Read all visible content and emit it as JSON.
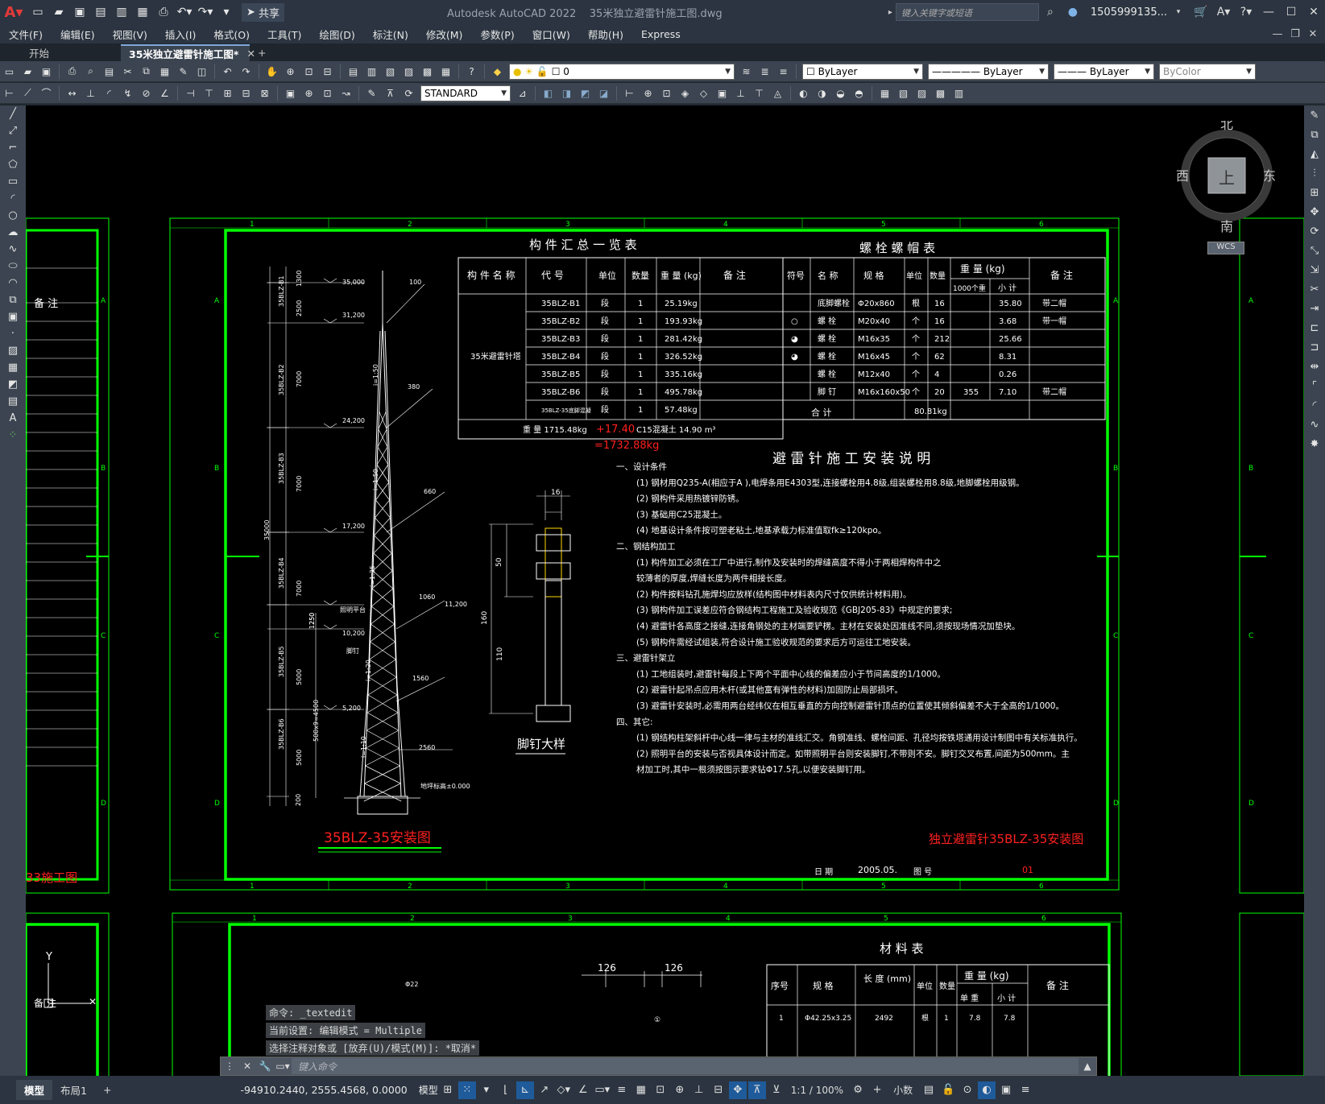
{
  "titlebar": {
    "app": "Autodesk AutoCAD 2022",
    "file": "35米独立避雷针施工图.dwg",
    "share": "共享",
    "search_placeholder": "键入关键字或短语",
    "user": "1505999135..."
  },
  "menu": [
    "文件(F)",
    "编辑(E)",
    "视图(V)",
    "插入(I)",
    "格式(O)",
    "工具(T)",
    "绘图(D)",
    "标注(N)",
    "修改(M)",
    "参数(P)",
    "窗口(W)",
    "帮助(H)",
    "Express"
  ],
  "tabs": [
    {
      "label": "开始"
    },
    {
      "label": "35米独立避雷针施工图*"
    }
  ],
  "toolbar": {
    "layer": "0",
    "color": "ByLayer",
    "linetype": "ByLayer",
    "lineweight": "ByLayer",
    "plotstyle": "ByColor",
    "textstyle": "STANDARD"
  },
  "compass": {
    "n": "北",
    "s": "南",
    "e": "东",
    "w": "西",
    "top": "上",
    "wcs": "WCS"
  },
  "drawing": {
    "table1_title": "构 件 汇 总 一 览 表",
    "table2_title": "螺  栓  螺  帽  表",
    "t1_headers": [
      "构 件 名 称",
      "代  号",
      "单位",
      "数量",
      "重 量 (kg)",
      "备   注"
    ],
    "t1_group": "35米避雷针塔",
    "t1_rows": [
      [
        "35BLZ-B1",
        "段",
        "1",
        "25.19kg"
      ],
      [
        "35BLZ-B2",
        "段",
        "1",
        "193.93kg"
      ],
      [
        "35BLZ-B3",
        "段",
        "1",
        "281.42kg"
      ],
      [
        "35BLZ-B4",
        "段",
        "1",
        "326.52kg"
      ],
      [
        "35BLZ-B5",
        "段",
        "1",
        "335.16kg"
      ],
      [
        "35BLZ-B6",
        "段",
        "1",
        "495.78kg"
      ],
      [
        "35BLZ-35底脚混凝",
        "段",
        "1",
        "57.48kg"
      ]
    ],
    "t1_total": "重  量    1715.48kg",
    "t1_total_add": "+17.40",
    "t1_total_conc": "C15混凝土    14.90 m³",
    "t1_total_sum": "=1732.88kg",
    "t2_headers": [
      "符号",
      "名 称",
      "规 格",
      "单位",
      "数量",
      "重 量 (kg)",
      "备   注"
    ],
    "t2_sub": [
      "1000个重",
      "小 计"
    ],
    "t2_rows": [
      [
        "",
        "底脚螺栓",
        "Φ20x860",
        "根",
        "16",
        "",
        "35.80",
        "带二帽"
      ],
      [
        "○",
        "螺  栓",
        "M20x40",
        "个",
        "16",
        "",
        "3.68",
        "带一帽"
      ],
      [
        "◕",
        "螺  栓",
        "M16x35",
        "个",
        "212",
        "",
        "25.66",
        ""
      ],
      [
        "◕",
        "螺  栓",
        "M16x45",
        "个",
        "62",
        "",
        "8.31",
        ""
      ],
      [
        "",
        "螺  栓",
        "M12x40",
        "个",
        "4",
        "",
        "0.26",
        ""
      ],
      [
        "",
        "脚  钉",
        "M16x160x50",
        "个",
        "20",
        "355",
        "7.10",
        "带二帽"
      ]
    ],
    "t2_total_label": "合    计",
    "t2_total": "80.81kg",
    "notes_title": "避 雷 针 施 工 安 装 说 明",
    "notes": [
      "一、设计条件",
      "(1) 钢材用Q235-A(相应于A ),电焊条用E4303型,连接螺栓用4.8级,组装螺栓用8.8级,地脚螺栓用级钢。",
      "(2) 钢构件采用热镀锌防锈。",
      "(3) 基础用C25混凝土。",
      "(4) 地基设计条件按可塑老粘土,地基承载力标准值取fk≥120kpo。",
      "二、钢结构加工",
      "(1) 构件加工必须在工厂中进行,制作及安装时的焊缝高度不得小于两相焊构件中之",
      "      较薄者的厚度,焊缝长度为两件相接长度。",
      "(2) 构件按料钻孔施焊均应放样(结构图中材料表内尺寸仅供统计材料用)。",
      "(3) 钢构件加工误差应符合钢结构工程施工及验收规范《GBJ205-83》中规定的要求;",
      "(4) 避雷针各高度之接缝,连接角钢处的主材端要铲楞。主材在安装处因准线不同,须按现场情况加垫块。",
      "(5) 钢构件需经试组装,符合设计施工验收规范的要求后方可运往工地安装。",
      "三、避雷针架立",
      "(1) 工地组装时,避雷针每段上下两个平面中心线的偏差应小于节间高度的1/1000。",
      "(2) 避雷针起吊点应用木杆(或其他富有弹性的材料)加固防止局部损坏。",
      "(3) 避雷针安装时,必需用两台经纬仪在相互垂直的方向控制避雷针顶点的位置使其倾斜偏差不大于全高的1/1000。",
      "四、其它:",
      "(1) 钢结构柱架斜杆中心线一律与主材的准线汇交。角钢准线、螺栓间距、孔径均按铁塔通用设计制图中有关标准执行。",
      "(2) 照明平台的安装与否视具体设计而定。如带照明平台则安装脚钉,不带则不安。脚钉交叉布置,间距为500mm。主",
      "      材加工时,其中一根须按图示要求钻Φ17.5孔,以便安装脚钉用。"
    ],
    "tower_title": "35BLZ-35安装图",
    "bolt_title": "脚钉大样",
    "sheet_title": "独立避雷针35BLZ-35安装图",
    "left_sheet_title": "33施工图",
    "date_label": "日  期",
    "date": "2005.05.",
    "sheet_no_label": "图  号",
    "sheet_no": "01",
    "remark": "备   注",
    "left_remark": "备   注",
    "elev": [
      "35,000",
      "31,200",
      "24,200",
      "17,200",
      "11,200",
      "10,200",
      "5,200"
    ],
    "seg": [
      "35BLZ-B1",
      "35BLZ-B2",
      "35BLZ-B3",
      "35BLZ-B4",
      "35BLZ-B5",
      "35BLZ-B6"
    ],
    "dims": [
      "1300",
      "2500",
      "7000",
      "7000",
      "7000",
      "5000",
      "5000",
      "1250",
      "200",
      "250",
      "35000",
      "500x9=4500"
    ],
    "slope": [
      "i=1:50",
      "i=1:50",
      "i=1:35",
      "i=1:20",
      "i=1:10"
    ],
    "widths": [
      "100",
      "380",
      "660",
      "1060",
      "1560",
      "2560"
    ],
    "labels": [
      "照明平台",
      "脚钉",
      "地坪标高±0.000"
    ],
    "bolt_dims": [
      "16",
      "50",
      "160",
      "110"
    ],
    "material_title": "材   料   表",
    "mat_headers": [
      "序号",
      "规 格",
      "长 度 (mm)",
      "单位",
      "数量",
      "重 量 (kg)",
      "备   注"
    ],
    "mat_sub": [
      "单 重",
      "小 计"
    ],
    "mat_row": [
      "1",
      "Φ42.25x3.25",
      "2492",
      "根",
      "1",
      "7.8",
      "7.8"
    ],
    "dim126": "126",
    "col_nums": [
      "1",
      "2",
      "3",
      "4",
      "5",
      "6"
    ],
    "row_letters": [
      "A",
      "B",
      "C",
      "D"
    ],
    "axis_y": "Y",
    "pile_label": "Φ22",
    "detail_mark": "①"
  },
  "command": {
    "lines": [
      "命令: _textedit",
      "当前设置: 编辑模式 = Multiple",
      "选择注释对象或 [放弃(U)/模式(M)]: *取消*"
    ],
    "placeholder": "键入命令"
  },
  "status": {
    "tabs": [
      "模型",
      "布局1"
    ],
    "coords": "-94910.2440, 2555.4568, 0.0000",
    "model": "模型",
    "scale": "1:1 / 100%",
    "units": "小数"
  }
}
